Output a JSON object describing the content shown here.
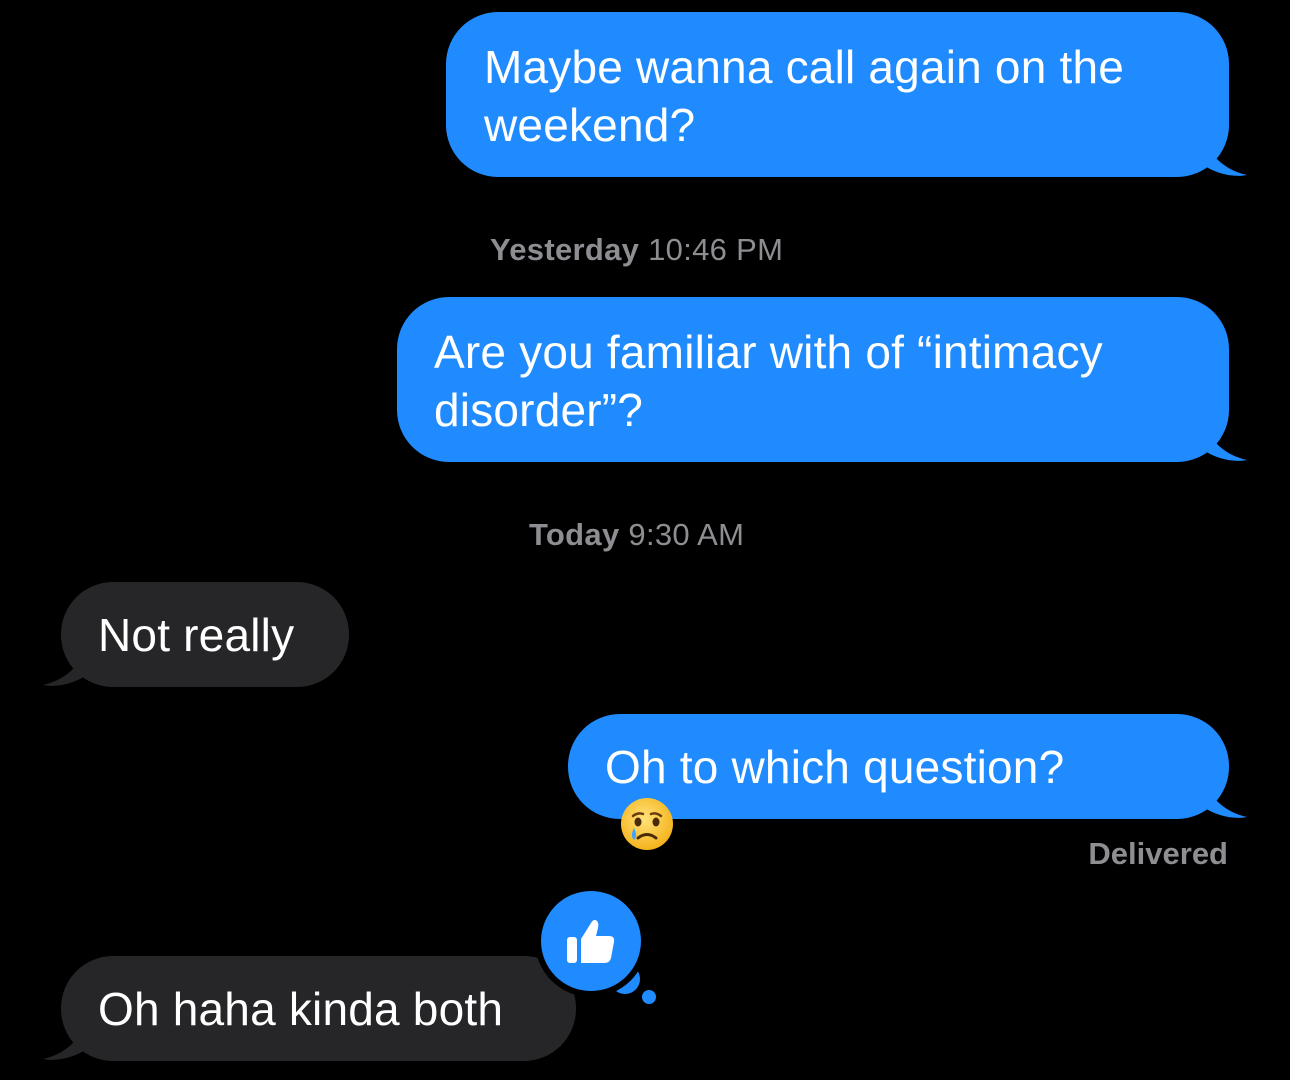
{
  "conversation": {
    "messages": [
      {
        "id": "m1",
        "direction": "sent",
        "text": "Maybe wanna call again on the weekend?"
      },
      {
        "id": "m2",
        "direction": "sent",
        "text": "Are you familiar with of “intimacy disorder”?"
      },
      {
        "id": "m3",
        "direction": "received",
        "text": "Not really"
      },
      {
        "id": "m4",
        "direction": "sent",
        "text": "Oh to which question?",
        "emoji": "crying-face"
      },
      {
        "id": "m5",
        "direction": "received",
        "text": "Oh haha kinda both",
        "tapback": "thumbs-up"
      }
    ],
    "timestamps": [
      {
        "day": "Yesterday",
        "time": "10:46 PM"
      },
      {
        "day": "Today",
        "time": "9:30 AM"
      }
    ],
    "status": "Delivered"
  },
  "colors": {
    "background": "#000000",
    "sent_bubble": "#1f8bff",
    "received_bubble": "#262628",
    "meta_text": "#8d8d92"
  },
  "icons": {
    "tapback": "thumbs-up-icon",
    "emoji": "crying-face-emoji-icon"
  }
}
